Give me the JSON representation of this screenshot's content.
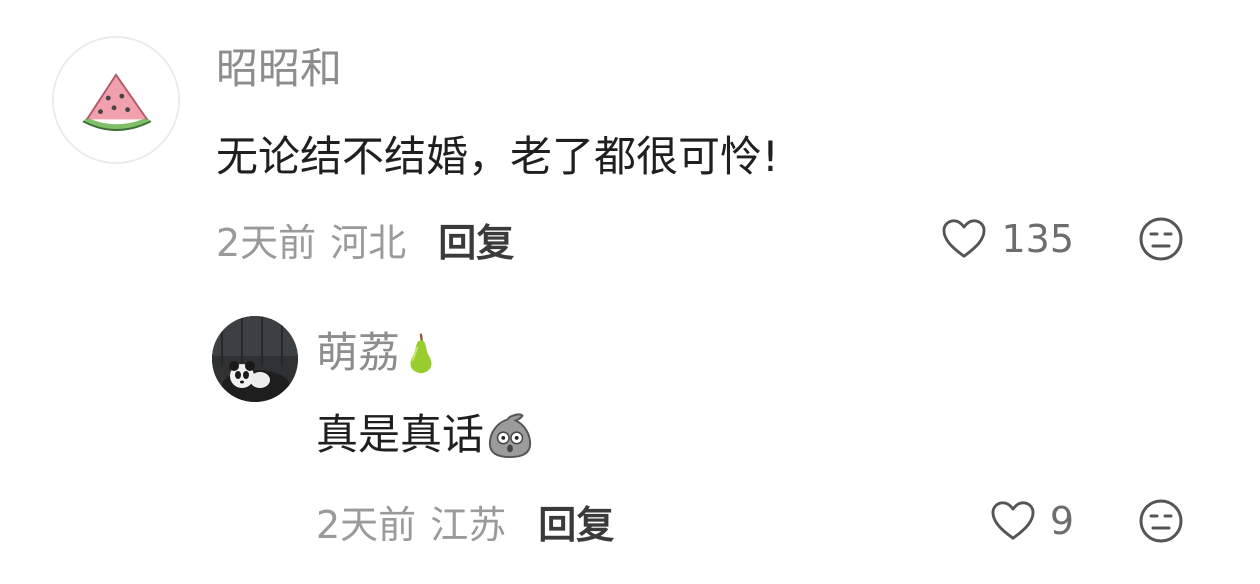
{
  "comments": [
    {
      "username": "昭昭和",
      "text": "无论结不结婚，老了都很可怜!",
      "time": "2天前",
      "location": "河北",
      "reply_label": "回复",
      "likes": "135",
      "avatar_icon": "watermelon-icon"
    },
    {
      "username": "萌荔",
      "username_emoji": "pear-icon",
      "text": "真是真话",
      "text_emoji": "surprised-sack-emoji",
      "time": "2天前",
      "location": "江苏",
      "reply_label": "回复",
      "likes": "9",
      "avatar_icon": "panda-icon"
    }
  ],
  "colors": {
    "username": "#8d8d8d",
    "text": "#1f1f1f",
    "meta": "#9a9a9a",
    "reply": "#3a3a3a"
  }
}
